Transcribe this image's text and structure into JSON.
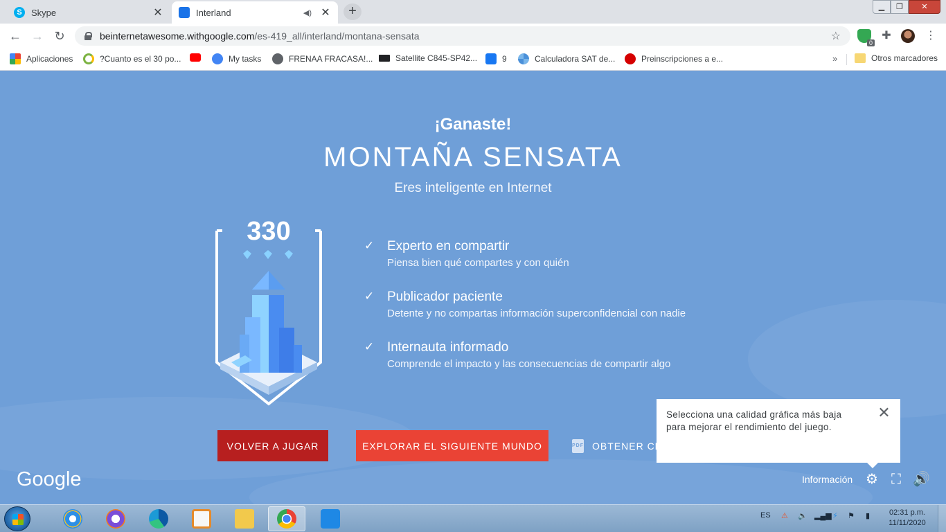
{
  "browser": {
    "tabs": [
      {
        "title": "Skype",
        "active": false
      },
      {
        "title": "Interland",
        "active": true
      }
    ],
    "url": {
      "host": "beinternetawesome.withgoogle.com",
      "path": "/es-419_all/interland/montana-sensata"
    },
    "extension_badge": "0",
    "bookmarks": [
      {
        "label": "Aplicaciones",
        "icon": "apps-grid-icon"
      },
      {
        "label": "?Cuanto es el 30 po...",
        "icon": "loading-icon"
      },
      {
        "label": "",
        "icon": "youtube-icon"
      },
      {
        "label": "My tasks",
        "icon": "tasks-icon"
      },
      {
        "label": "FRENAA FRACASA!...",
        "icon": "globe-icon"
      },
      {
        "label": "Satellite C845-SP42...",
        "icon": "toshiba-icon"
      },
      {
        "label": "9",
        "icon": "facebook-icon"
      },
      {
        "label": "Calculadora SAT de...",
        "icon": "sat-icon"
      },
      {
        "label": "Preinscripciones a e...",
        "icon": "red-circle-icon"
      }
    ],
    "bookmarks_overflow": "»",
    "other_bookmarks": "Otros marcadores"
  },
  "game": {
    "win_title": "¡Ganaste!",
    "world_title": "MONTAÑA SENSATA",
    "subtitle": "Eres inteligente en Internet",
    "score": "330",
    "achievements": [
      {
        "title": "Experto en compartir",
        "desc": "Piensa bien qué compartes y con quién"
      },
      {
        "title": "Publicador paciente",
        "desc": "Detente y no compartas información superconfidencial con nadie"
      },
      {
        "title": "Internauta informado",
        "desc": "Comprende el impacto y las consecuencias de compartir algo"
      }
    ],
    "buttons": {
      "replay": "VOLVER A JUGAR",
      "next": "EXPLORAR EL SIGUIENTE MUNDO",
      "certificate": "OBTENER CE",
      "pdf_label": "PDF"
    },
    "logo": "Google",
    "tooltip": "Selecciona una calidad gráfica más baja para mejorar el rendimiento del juego.",
    "info_link": "Información"
  },
  "taskbar": {
    "apps": [
      "internet-explorer",
      "avast",
      "edge",
      "media-player",
      "file-explorer",
      "chrome",
      "vs-code"
    ],
    "active_app": "chrome",
    "language": "ES",
    "time": "02:31 p.m.",
    "date": "11/11/2020"
  }
}
